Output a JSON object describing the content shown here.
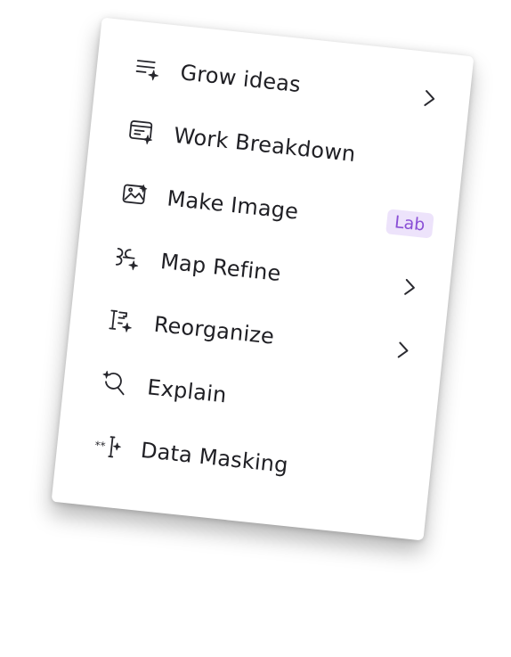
{
  "colors": {
    "text": "#1f1f24",
    "badge_bg": "#ede3fb",
    "badge_text": "#8a4fd6"
  },
  "menu": {
    "items": [
      {
        "label": "Grow ideas",
        "icon": "list-sparkle-icon",
        "has_submenu": true
      },
      {
        "label": "Work Breakdown",
        "icon": "document-sparkle-icon",
        "has_submenu": false
      },
      {
        "label": "Make Image",
        "icon": "image-sparkle-icon",
        "badge": "Lab"
      },
      {
        "label": "Map Refine",
        "icon": "mindmap-sparkle-icon",
        "has_submenu": true
      },
      {
        "label": "Reorganize",
        "icon": "outline-sparkle-icon",
        "has_submenu": true
      },
      {
        "label": "Explain",
        "icon": "magnifier-sparkle-icon",
        "has_submenu": false
      },
      {
        "label": "Data Masking",
        "icon": "mask-sparkle-icon",
        "has_submenu": false
      }
    ]
  }
}
